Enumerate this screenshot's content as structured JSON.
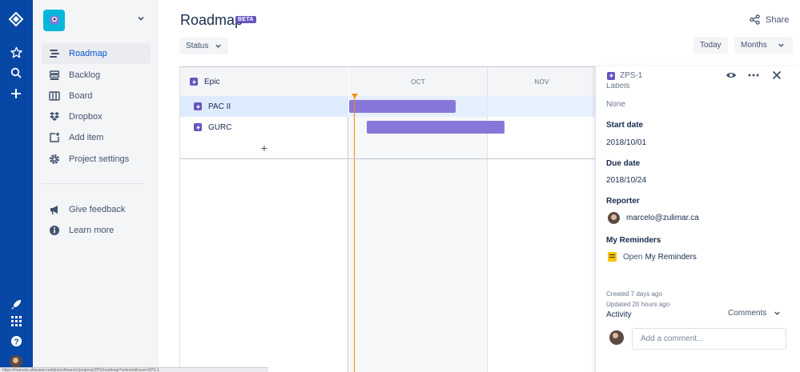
{
  "colors": {
    "rail": "#0747a6",
    "accent": "#0052cc",
    "epic": "#6554c0",
    "bar": "#8777d9",
    "today": "#ff8b00"
  },
  "rail": {
    "top_icons": [
      "jira-logo-icon",
      "star-icon",
      "search-icon",
      "plus-icon"
    ],
    "bottom_icons": [
      "rocket-icon",
      "app-switcher-icon",
      "help-icon",
      "avatar"
    ]
  },
  "sidebar": {
    "nav": [
      {
        "label": "Roadmap",
        "icon": "roadmap-icon",
        "active": true
      },
      {
        "label": "Backlog",
        "icon": "backlog-icon"
      },
      {
        "label": "Board",
        "icon": "board-icon"
      },
      {
        "label": "Dropbox",
        "icon": "dropbox-icon"
      },
      {
        "label": "Add item",
        "icon": "add-item-icon"
      },
      {
        "label": "Project settings",
        "icon": "gear-icon"
      }
    ],
    "secondary": [
      {
        "label": "Give feedback",
        "icon": "megaphone-icon"
      },
      {
        "label": "Learn more",
        "icon": "info-icon"
      }
    ]
  },
  "header": {
    "title": "Roadmap",
    "badge": "BETA",
    "share_label": "Share"
  },
  "toolbar": {
    "status_label": "Status",
    "today_label": "Today",
    "months_label": "Months"
  },
  "roadmap": {
    "epic_header": "Epic",
    "epics": [
      {
        "name": "PAC II",
        "selected": true,
        "start": "2018-10-01",
        "end": "2018-10-24"
      },
      {
        "name": "GURC",
        "start": "2018-10-05",
        "end": "2018-10-31"
      }
    ],
    "add_label": "+",
    "months": [
      "OCT",
      "NOV"
    ]
  },
  "detail": {
    "issue_key": "ZPS-1",
    "labels_label": "Labels",
    "labels_value": "None",
    "start_label": "Start date",
    "start_value": "2018/10/01",
    "due_label": "Due date",
    "due_value": "2018/10/24",
    "reporter_label": "Reporter",
    "reporter_value": "marcelo@zulimar.ca",
    "reminders_label": "My Reminders",
    "reminders_open": "Open",
    "reminders_link": "My Reminders",
    "created": "Created 7 days ago",
    "updated": "Updated 20 hours ago",
    "activity_label": "Activity",
    "comments_label": "Comments",
    "comment_placeholder": "Add a comment..."
  },
  "statusbar_text": "https://marcelo.atlassian.net/jira/software/c/projects/ZPS/roadmap?selectedIssue=ZPS-1"
}
